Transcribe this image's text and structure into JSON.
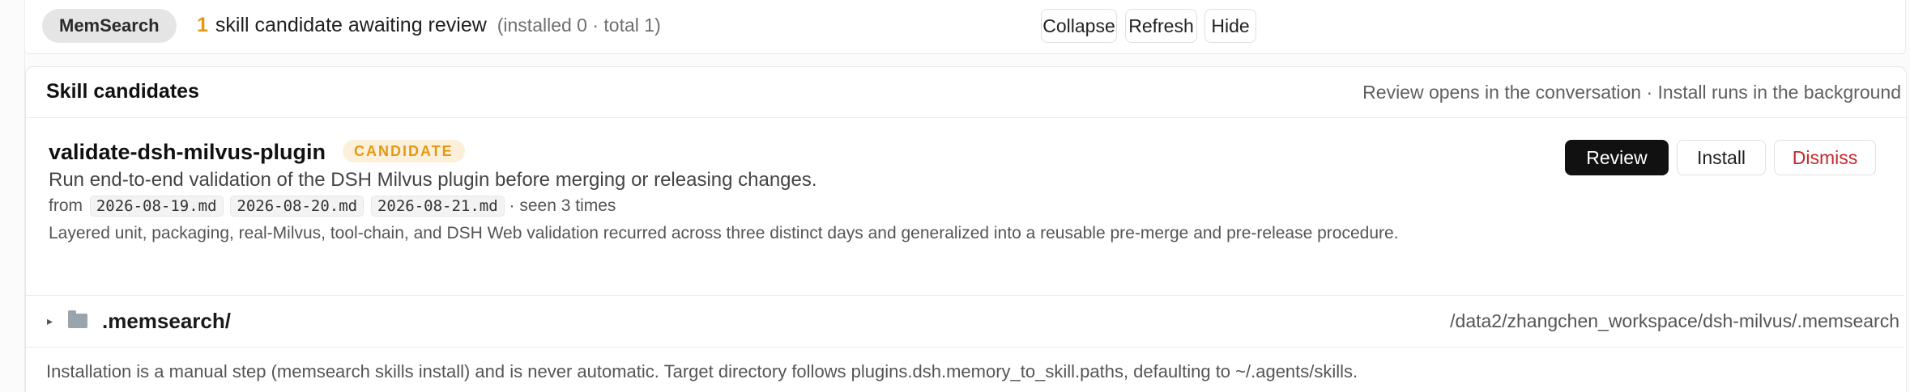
{
  "topbar": {
    "pill_label": "MemSearch",
    "count": "1",
    "summary_text": "skill candidate awaiting review",
    "summary_sub": "(installed 0 · total 1)",
    "collapse_label": "Collapse",
    "refresh_label": "Refresh",
    "hide_label": "Hide"
  },
  "panel": {
    "title": "Skill candidates",
    "note": "Review opens in the conversation · Install runs in the background"
  },
  "candidate": {
    "name": "validate-dsh-milvus-plugin",
    "badge": "CANDIDATE",
    "description": "Run end-to-end validation of the DSH Milvus plugin before merging or releasing changes.",
    "from_label": "from",
    "files": [
      "2026-08-19.md",
      "2026-08-20.md",
      "2026-08-21.md"
    ],
    "seen_text": "· seen 3 times",
    "reason": "Layered unit, packaging, real-Milvus, tool-chain, and DSH Web validation recurred across three distinct days and generalized into a reusable pre-merge and pre-release procedure.",
    "review_label": "Review",
    "install_label": "Install",
    "dismiss_label": "Dismiss"
  },
  "folder": {
    "caret": "▸",
    "icon": "folder-icon",
    "name": ".memsearch/",
    "path": "/data2/zhangchen_workspace/dsh-milvus/.memsearch"
  },
  "footnote": "Installation is a manual step (memsearch skills install) and is never automatic. Target directory follows plugins.dsh.memory_to_skill.paths, defaulting to ~/.agents/skills."
}
